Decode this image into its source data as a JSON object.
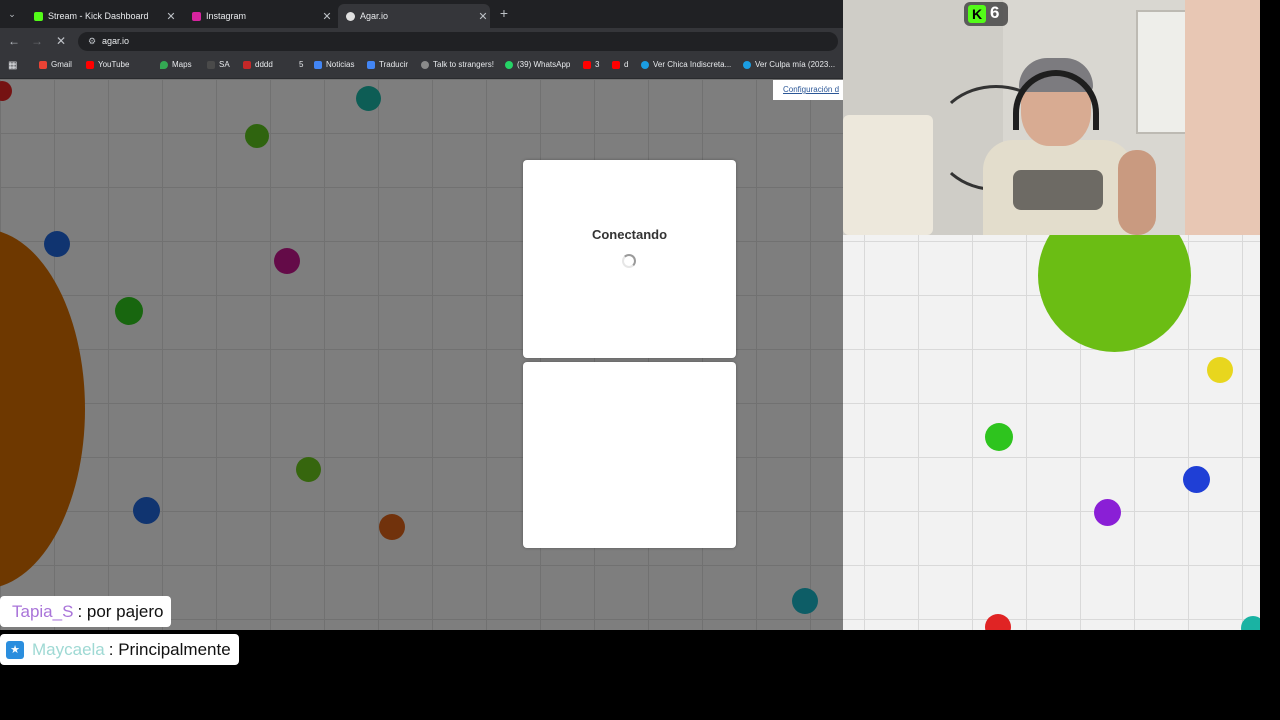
{
  "browser": {
    "tabs": [
      {
        "label": "Stream - Kick Dashboard",
        "favicon": "kick-icon",
        "color": "#53fc18",
        "active": false
      },
      {
        "label": "Instagram",
        "favicon": "instagram-icon",
        "color": "#d6249f",
        "active": false
      },
      {
        "label": "Agar.io",
        "favicon": "agario-icon",
        "color": "#e0e0e0",
        "active": true
      }
    ],
    "url": "agar.io",
    "bookmarks": [
      {
        "label": "Gmail",
        "icon": "gmail-icon",
        "color": "#ea4335"
      },
      {
        "label": "YouTube",
        "icon": "youtube-icon",
        "color": "#ff0000"
      },
      {
        "label": "Maps",
        "icon": "maps-icon",
        "color": "#34a853"
      },
      {
        "label": "SA",
        "icon": "site-icon",
        "color": "#4a4a4a"
      },
      {
        "label": "dddd",
        "icon": "bookmark-icon",
        "color": "#c62828"
      },
      {
        "label": "5",
        "icon": "",
        "color": ""
      },
      {
        "label": "Noticias",
        "icon": "news-icon",
        "color": "#4285f4"
      },
      {
        "label": "Traducir",
        "icon": "translate-icon",
        "color": "#4285f4"
      },
      {
        "label": "Talk to strangers!",
        "icon": "omegle-icon",
        "color": "#8a8a8a"
      },
      {
        "label": "(39) WhatsApp",
        "icon": "whatsapp-icon",
        "color": "#25d366"
      },
      {
        "label": "3",
        "icon": "youtube-icon",
        "color": "#ff0000"
      },
      {
        "label": "d",
        "icon": "youtube-icon",
        "color": "#ff0000"
      },
      {
        "label": "Ver Chica Indiscreta...",
        "icon": "edge-icon",
        "color": "#1b9de2"
      },
      {
        "label": "Ver Culpa mía (2023...",
        "icon": "edge-icon",
        "color": "#1b9de2"
      }
    ]
  },
  "game": {
    "settings_link": "Configuración d",
    "status": "Conectando"
  },
  "stream": {
    "viewer_count": "6"
  },
  "chat": [
    {
      "user": "Tapia_S",
      "message": ": por pajero"
    },
    {
      "user": "Maycaela",
      "message": ": Principalmente"
    }
  ]
}
